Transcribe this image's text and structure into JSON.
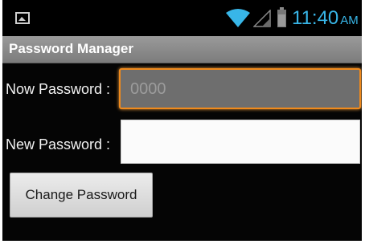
{
  "statusbar": {
    "time": "11:40",
    "ampm": "AM",
    "icons": [
      "notification-icon",
      "wifi-icon",
      "signal-icon",
      "battery-icon"
    ],
    "accent_color": "#38b6e8"
  },
  "app": {
    "title": "Password Manager"
  },
  "form": {
    "now_password_label": "Now Password :",
    "now_password_value": "0000",
    "new_password_label": "New Password :",
    "new_password_value": "",
    "change_button_label": "Change Password",
    "focus_color": "#f08a1c"
  }
}
